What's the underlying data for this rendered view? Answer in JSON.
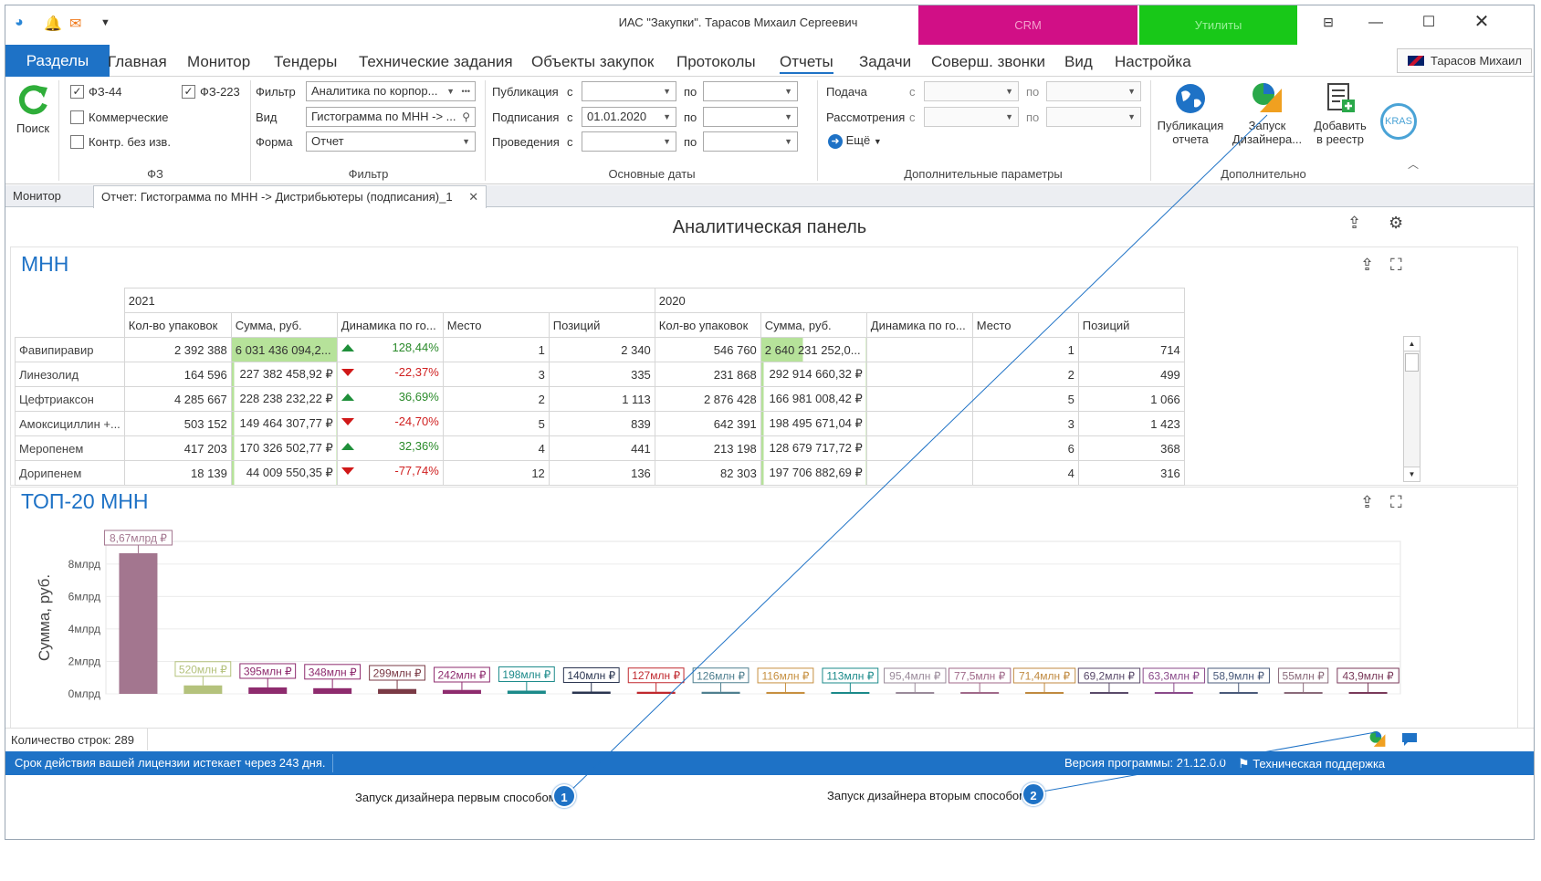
{
  "window": {
    "title": "ИАС \"Закупки\". Тарасов Михаил Сергеевич",
    "crm_label": "CRM",
    "utilities_label": "Утилиты",
    "user_name": "Тарасов Михаил"
  },
  "menu": {
    "items": [
      "Разделы",
      "Главная",
      "Монитор",
      "Тендеры",
      "Технические задания",
      "Объекты закупок",
      "Протоколы",
      "Отчеты",
      "Задачи",
      "Соверш. звонки",
      "Вид",
      "Настройка"
    ],
    "active": "Разделы",
    "underlined": "Отчеты"
  },
  "ribbon": {
    "search_label": "Поиск",
    "fz": {
      "fz44": "ФЗ-44",
      "fz44_checked": true,
      "fz223": "ФЗ-223",
      "fz223_checked": true,
      "commercial": "Коммерческие",
      "commercial_checked": false,
      "contr": "Контр. без изв.",
      "contr_checked": false,
      "group": "ФЗ"
    },
    "filter": {
      "filter_label": "Фильтр",
      "filter_value": "Аналитика по корпор...",
      "view_label": "Вид",
      "view_value": "Гистограмма по МНН -> ...",
      "form_label": "Форма",
      "form_value": "Отчет",
      "group": "Фильтр"
    },
    "dates": {
      "pub_label": "Публикация",
      "sign_label": "Подписания",
      "hold_label": "Проведения",
      "from": "с",
      "to": "по",
      "sign_from_value": "01.01.2020",
      "group": "Основные даты"
    },
    "extra": {
      "submit_label": "Подача",
      "review_label": "Рассмотрения",
      "from": "с",
      "to": "по",
      "more_label": "Ещё",
      "group": "Дополнительные параметры"
    },
    "addl": {
      "publish_label_1": "Публикация",
      "publish_label_2": "отчета",
      "designer_label_1": "Запуск",
      "designer_label_2": "Дизайнера...",
      "add_label_1": "Добавить",
      "add_label_2": "в реестр",
      "group": "Дополнительно",
      "logo_text": "KRAS"
    }
  },
  "tabs": {
    "monitor": "Монитор",
    "report": "Отчет: Гистограмма по МНН -> Дистрибьютеры (подписания)_1"
  },
  "dashboard": {
    "title": "Аналитическая панель",
    "mnn_title": "МНН",
    "top20_title": "ТОП-20 МНН"
  },
  "table": {
    "year_2021": "2021",
    "year_2020": "2020",
    "columns": [
      "Кол-во упаковок",
      "Сумма, руб.",
      "Динамика по го...",
      "Место",
      "Позиций",
      "Кол-во упаковок",
      "Сумма, руб.",
      "Динамика по го...",
      "Место",
      "Позиций"
    ],
    "rows": [
      {
        "name": "Фавипиравир",
        "q21": "2 392 388",
        "s21": "6 031 436 094,2...",
        "dyn": "128,44%",
        "dir": "up",
        "p21": "1",
        "pos21": "2 340",
        "q20": "546 760",
        "s20": "2 640 231 252,0...",
        "p20": "1",
        "pos20": "714"
      },
      {
        "name": "Линезолид",
        "q21": "164 596",
        "s21": "227 382 458,92 ₽",
        "dyn": "-22,37%",
        "dir": "down",
        "p21": "3",
        "pos21": "335",
        "q20": "231 868",
        "s20": "292 914 660,32 ₽",
        "p20": "2",
        "pos20": "499"
      },
      {
        "name": "Цефтриаксон",
        "q21": "4 285 667",
        "s21": "228 238 232,22 ₽",
        "dyn": "36,69%",
        "dir": "up",
        "p21": "2",
        "pos21": "1 113",
        "q20": "2 876 428",
        "s20": "166 981 008,42 ₽",
        "p20": "5",
        "pos20": "1 066"
      },
      {
        "name": "Амоксициллин +...",
        "q21": "503 152",
        "s21": "149 464 307,77 ₽",
        "dyn": "-24,70%",
        "dir": "down",
        "p21": "5",
        "pos21": "839",
        "q20": "642 391",
        "s20": "198 495 671,04 ₽",
        "p20": "3",
        "pos20": "1 423"
      },
      {
        "name": "Меропенем",
        "q21": "417 203",
        "s21": "170 326 502,77 ₽",
        "dyn": "32,36%",
        "dir": "up",
        "p21": "4",
        "pos21": "441",
        "q20": "213 198",
        "s20": "128 679 717,72 ₽",
        "p20": "6",
        "pos20": "368"
      },
      {
        "name": "Дорипенем",
        "q21": "18 139",
        "s21": "44 009 550,35 ₽",
        "dyn": "-77,74%",
        "dir": "down",
        "p21": "12",
        "pos21": "136",
        "q20": "82 303",
        "s20": "197 706 882,69 ₽",
        "p20": "4",
        "pos20": "316"
      }
    ]
  },
  "chart_data": {
    "type": "bar",
    "title": "ТОП-20 МНН",
    "ylabel": "Сумма, руб.",
    "yunit": "млрд",
    "ylim": [
      0,
      9.4
    ],
    "yticks": [
      "0млрд",
      "2млрд",
      "4млрд",
      "6млрд",
      "8млрд"
    ],
    "values": [
      8.67,
      0.52,
      0.395,
      0.348,
      0.299,
      0.242,
      0.198,
      0.14,
      0.127,
      0.126,
      0.116,
      0.113,
      0.0954,
      0.0775,
      0.0714,
      0.0692,
      0.0633,
      0.0589,
      0.055,
      0.0439
    ],
    "labels": [
      "8,67млрд ₽",
      "520млн ₽",
      "395млн ₽",
      "348млн ₽",
      "299млн ₽",
      "242млн ₽",
      "198млн ₽",
      "140млн ₽",
      "127млн ₽",
      "126млн ₽",
      "116млн ₽",
      "113млн ₽",
      "95,4млн ₽",
      "77,5млн ₽",
      "71,4млн ₽",
      "69,2млн ₽",
      "63,3млн ₽",
      "58,9млн ₽",
      "55млн ₽",
      "43,9млн ₽"
    ],
    "colors": [
      "#a3768f",
      "#b4c27c",
      "#8e2b6e",
      "#8e2b6e",
      "#7a3a45",
      "#8e2b6e",
      "#1b8a8a",
      "#2a3550",
      "#c0282e",
      "#4f7f8f",
      "#c79040",
      "#1b8a8a",
      "#9a8a9a",
      "#a06a8a",
      "#c08a40",
      "#5a4a6a",
      "#8a4a8a",
      "#4a5a7a",
      "#8a6a7a",
      "#7a3a5a"
    ],
    "grid": true
  },
  "status": {
    "row_count": "Количество строк: 289",
    "license": "Срок действия вашей лицензии истекает через 243 дня.",
    "version": "Версия программы: 21.12.0.0",
    "support": "Техническая поддержка"
  },
  "callouts": {
    "c1_text": "Запуск дизайнера первым способом",
    "c1_num": "1",
    "c2_text": "Запуск дизайнера вторым способом",
    "c2_num": "2"
  }
}
